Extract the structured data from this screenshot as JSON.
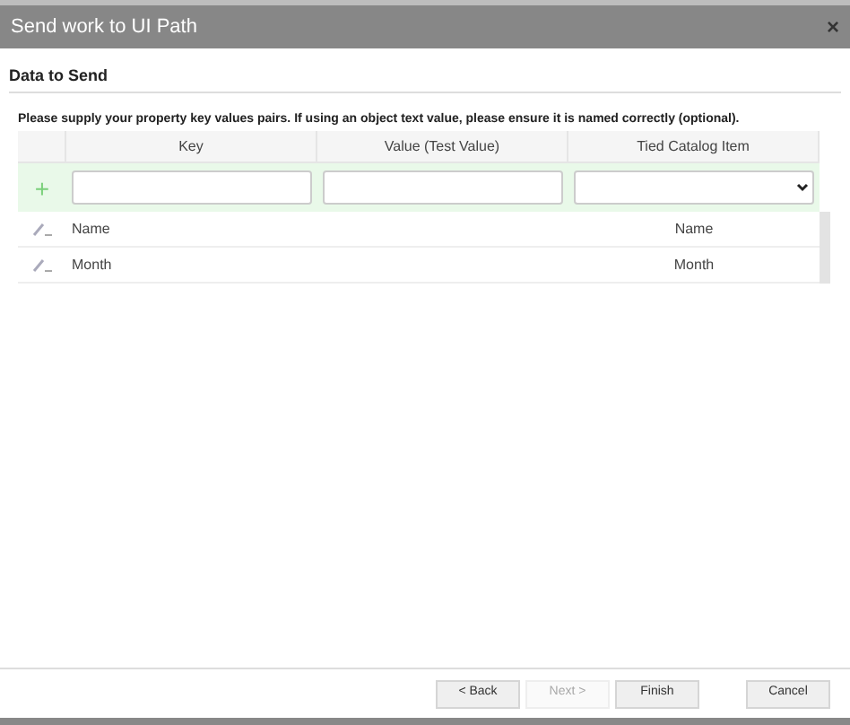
{
  "window": {
    "title": "Send work to UI Path",
    "close": "×"
  },
  "section": {
    "title": "Data to Send"
  },
  "instructions": "Please supply your property key values pairs. If using an object text value, please ensure it is named correctly (optional).",
  "table": {
    "columns": [
      "Key",
      "Value (Test Value)",
      "Tied Catalog Item"
    ],
    "new_row": {
      "add": "+"
    },
    "rows": [
      {
        "key": "Name",
        "value": "",
        "tied": "Name"
      },
      {
        "key": "Month",
        "value": "",
        "tied": "Month"
      }
    ]
  },
  "buttons": [
    {
      "label": "< Back",
      "disabled": false
    },
    {
      "label": "Next >",
      "disabled": true
    },
    {
      "label": "Finish",
      "disabled": false
    },
    {
      "label": "Cancel",
      "disabled": false
    }
  ]
}
